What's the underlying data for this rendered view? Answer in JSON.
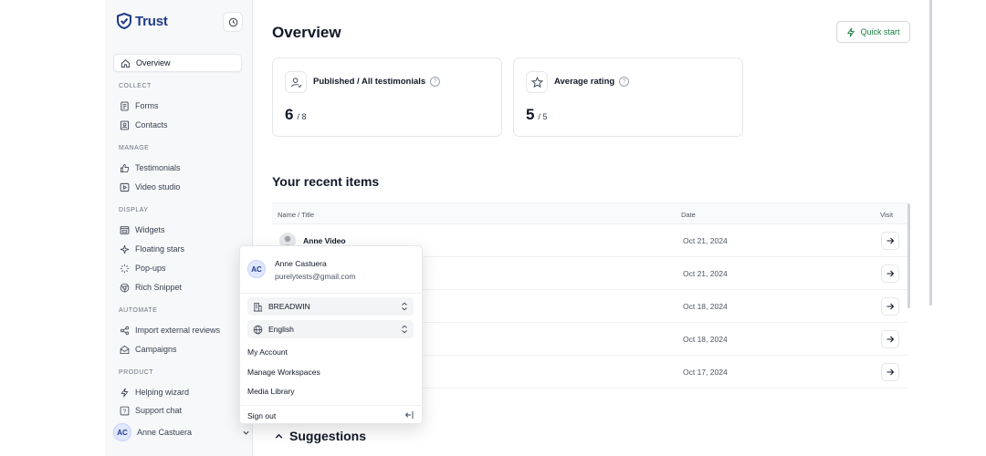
{
  "brand": {
    "name": "Trust"
  },
  "sidebar": {
    "overview": "Overview",
    "sections": {
      "collect": "COLLECT",
      "manage": "MANAGE",
      "display": "DISPLAY",
      "automate": "AUTOMATE",
      "product": "PRODUCT"
    },
    "items": {
      "forms": "Forms",
      "contacts": "Contacts",
      "testimonials": "Testimonials",
      "video_studio": "Video studio",
      "widgets": "Widgets",
      "floating_stars": "Floating stars",
      "popups": "Pop-ups",
      "rich_snippet": "Rich Snippet",
      "import_reviews": "Import external reviews",
      "campaigns": "Campaigns",
      "helping_wizard": "Helping wizard",
      "support_chat": "Support chat"
    },
    "user": {
      "initials": "AC",
      "name": "Anne Castuera"
    }
  },
  "main": {
    "title": "Overview",
    "quick_start": "Quick start",
    "stats": [
      {
        "label": "Published / All testimonials",
        "value": "6",
        "total": "/ 8"
      },
      {
        "label": "Average rating",
        "value": "5",
        "total": "/ 5"
      }
    ],
    "recent_title": "Your recent items",
    "table": {
      "headers": {
        "name": "Name / Title",
        "date": "Date",
        "visit": "Visit"
      },
      "rows": [
        {
          "name": "Anne Video",
          "date": "Oct 21, 2024"
        },
        {
          "name": "",
          "date": "Oct 21, 2024"
        },
        {
          "name": "",
          "date": "Oct 18, 2024"
        },
        {
          "name": "",
          "date": "Oct 18, 2024"
        },
        {
          "name": "",
          "date": "Oct 17, 2024"
        }
      ]
    },
    "suggestions": "Suggestions"
  },
  "popup": {
    "initials": "AC",
    "name": "Anne Castuera",
    "email": "purelytests@gmail.com",
    "workspace": "BREADWIN",
    "language": "English",
    "links": {
      "account": "My Account",
      "workspaces": "Manage Workspaces",
      "media": "Media Library",
      "signout": "Sign out"
    }
  }
}
